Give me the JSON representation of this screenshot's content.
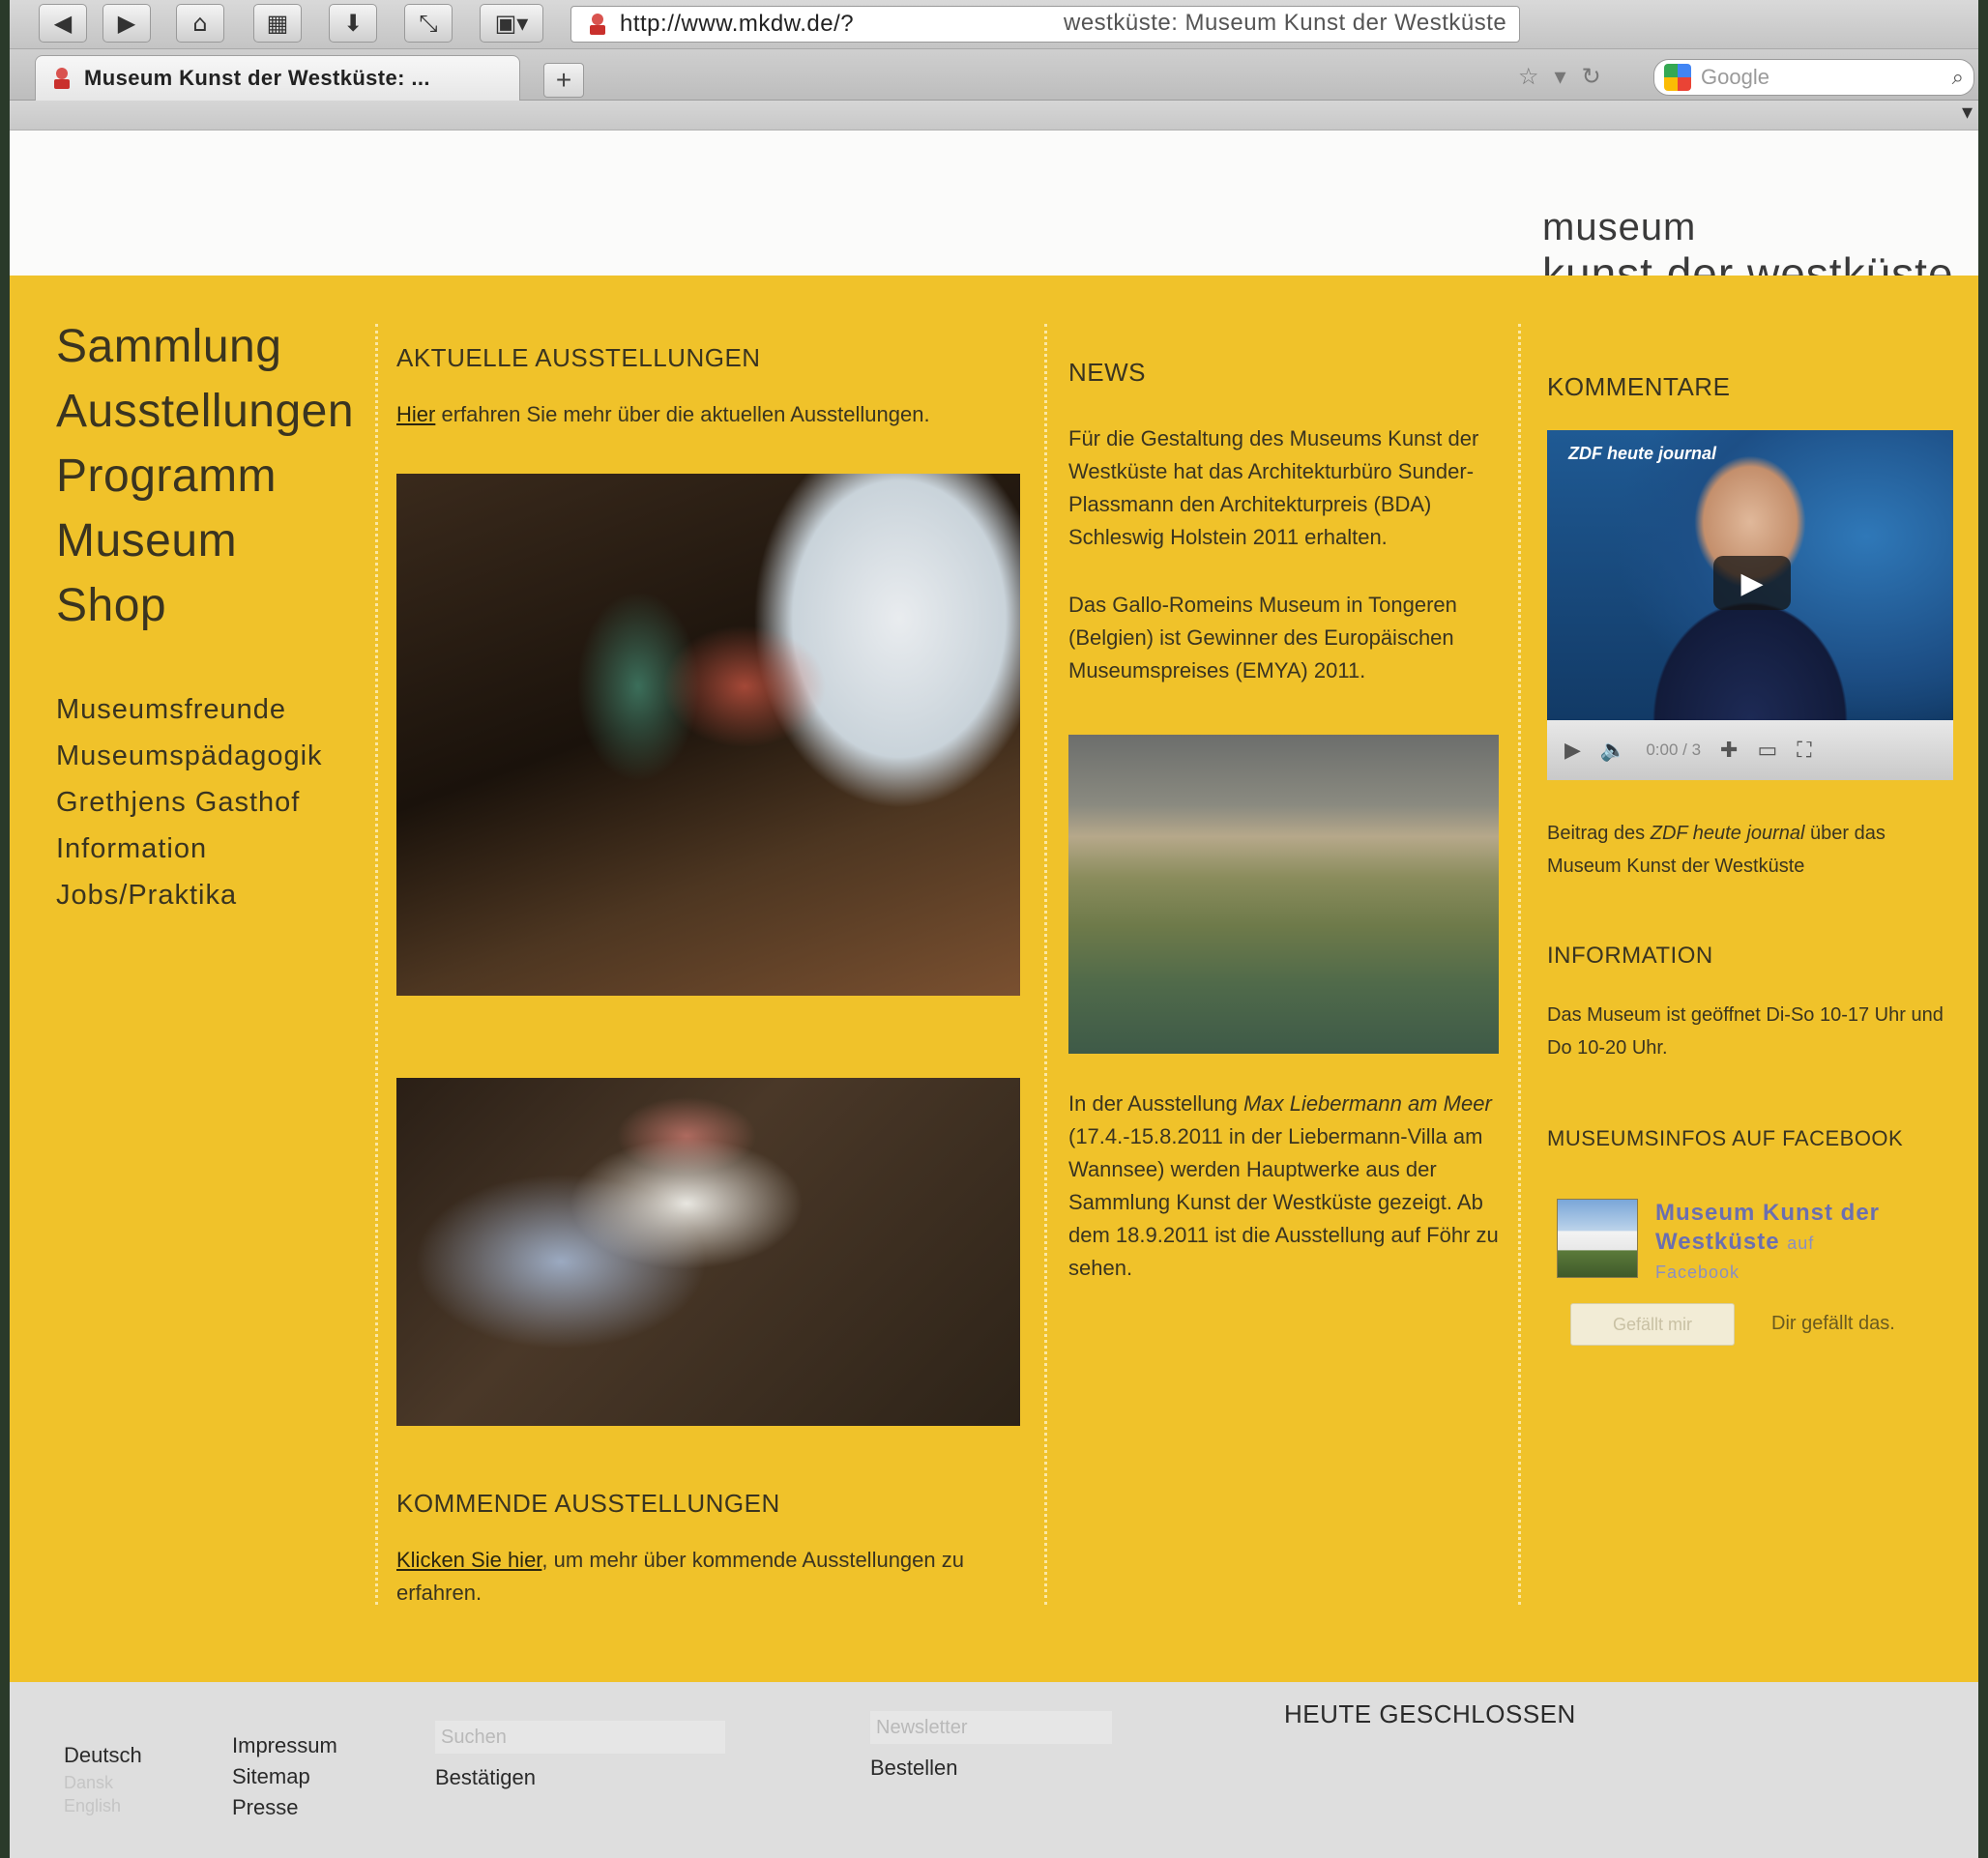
{
  "browser": {
    "window_title": "westküste: Museum Kunst der Westküste",
    "url": "http://www.mkdw.de/?",
    "tab_title": "Museum Kunst der Westküste: ...",
    "new_tab": "+",
    "search_placeholder": "Google",
    "icons": {
      "back": "back-arrow-icon",
      "forward": "forward-arrow-icon",
      "home": "home-icon",
      "bookmarks": "bookmarks-icon",
      "download": "download-icon",
      "fullscreen": "fullscreen-icon",
      "addon": "addon-icon"
    }
  },
  "logo": {
    "line1": "museum",
    "line2": "kunst der westküste"
  },
  "colors": {
    "accent_yellow": "#f0c22a",
    "footer_bg": "#dedede",
    "text_dark": "#3a3420",
    "fb_link": "#6b6fb0"
  },
  "nav": {
    "main": [
      "Sammlung",
      "Ausstellungen",
      "Programm",
      "Museum",
      "Shop"
    ],
    "sub": [
      "Museumsfreunde",
      "Museumspädagogik",
      "Grethjens Gasthof",
      "Information",
      "Jobs/Praktika"
    ]
  },
  "current": {
    "title": "AKTUELLE AUSSTELLUNGEN",
    "link": "Hier",
    "text": " erfahren Sie mehr über die aktuellen Ausstellungen."
  },
  "upcoming": {
    "title": "KOMMENDE AUSSTELLUNGEN",
    "link": "Klicken Sie hier",
    "text": ", um mehr über kommende Ausstellungen zu erfahren."
  },
  "news": {
    "title": "NEWS",
    "item1": "Für die Gestaltung des Museums Kunst der Westküste hat das Architekturbüro Sunder-Plassmann den Architekturpreis (BDA) Schleswig Holstein 2011 erhalten.",
    "item2": "Das Gallo-Romeins Museum in Tongeren (Belgien) ist Gewinner des Europäischen Museumspreises (EMYA) 2011.",
    "item3_before": "In der Ausstellung ",
    "item3_em": "Max Liebermann am Meer",
    "item3_after": " (17.4.-15.8.2011 in der Liebermann-Villa am Wannsee) werden Hauptwerke aus der Sammlung Kunst der Westküste gezeigt. Ab dem 18.9.2011 ist die Ausstellung auf Föhr zu sehen."
  },
  "comments": {
    "title": "KOMMENTARE",
    "video_caption": "ZDF heute journal",
    "video_time": "0:00 / 3",
    "video_caption_text_before": "Beitrag des ",
    "video_caption_em": "ZDF heute journal",
    "video_caption_text_after": " über das Museum Kunst der Westküste"
  },
  "information": {
    "title": "INFORMATION",
    "text": "Das Museum ist geöffnet Di-So 10-17 Uhr und Do 10-20 Uhr."
  },
  "facebook": {
    "title": "MUSEUMSINFOS AUF FACEBOOK",
    "name": "Museum Kunst der Westküste",
    "suffix": "auf",
    "platform": "Facebook",
    "like_button": "Gefällt mir",
    "like_text": "Dir gefällt das."
  },
  "footer": {
    "lang_de": "Deutsch",
    "lang_dk": "Dansk",
    "lang_en": "English",
    "impressum": "Impressum",
    "sitemap": "Sitemap",
    "presse": "Presse",
    "search_placeholder": "Suchen",
    "search_submit": "Bestätigen",
    "newsletter_placeholder": "Newsletter",
    "newsletter_submit": "Bestellen",
    "status": "HEUTE GESCHLOSSEN"
  }
}
